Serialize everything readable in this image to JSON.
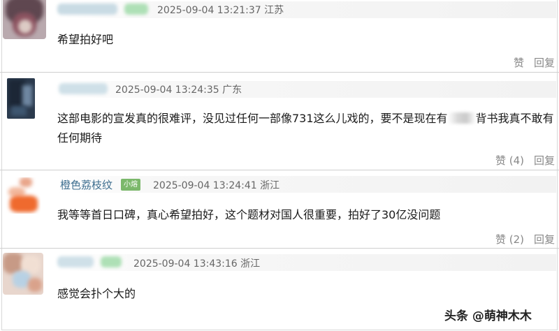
{
  "comments": [
    {
      "username": "",
      "meta": "2025-09-04 13:21:37 江苏",
      "text": "希望拍好吧",
      "like": "赞",
      "reply": "回复"
    },
    {
      "username": "",
      "meta": "2025-09-04 13:24:35 广东",
      "text_before": "这部电影的宣发真的很难评，没见过任何一部像731这么儿戏的，要不是现在有",
      "text_after": "背书我真不敢有任何期待",
      "like": "赞 (4)",
      "reply": "回复"
    },
    {
      "username": "橙色荔枝纹",
      "badge": "小熔",
      "meta": "2025-09-04 13:24:41 浙江",
      "text": "我等等首日口碑，真心希望拍好，这个题材对国人很重要，拍好了30亿没问题",
      "like": "赞 (2)",
      "reply": "回复"
    },
    {
      "username": "",
      "meta": "2025-09-04 13:43:16 浙江",
      "text": "感觉会扑个大的"
    }
  ],
  "watermark": "头条 @萌神木木",
  "colors": {
    "username": "#3d6e8f",
    "badge": "#7bb86b",
    "meta": "#666666",
    "actions": "#888888"
  }
}
